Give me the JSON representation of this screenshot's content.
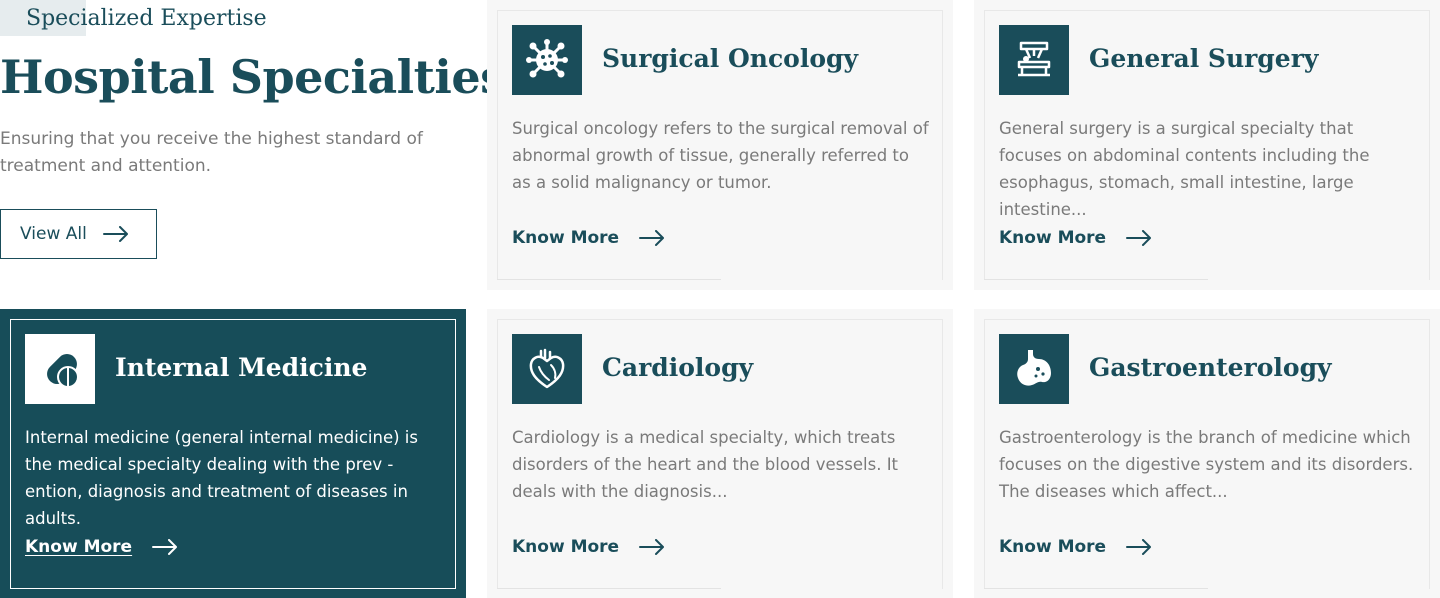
{
  "intro": {
    "eyebrow": "Specialized Expertise",
    "title": "Hospital Specialties",
    "description": "Ensuring that you receive the highest standard of treatment and attention.",
    "view_all_label": "View All"
  },
  "colors": {
    "brand": "#1a4d5a",
    "active_card": "#174d59",
    "card_bg": "#f7f7f7",
    "muted_text": "#7a7a7a"
  },
  "cards": [
    {
      "title": "Surgical Oncology",
      "icon": "cancer-cell-icon",
      "description": "Surgical oncology refers to the surgical removal of abnormal growth of tissue, generally referred to as a solid malignancy or tumor.",
      "link_label": "Know More",
      "active": false
    },
    {
      "title": "General Surgery",
      "icon": "surgery-table-icon",
      "description": "General surgery is a surgical specialty that focuses on abdominal contents including the esophagus, stomach, small intestine, large intestine...",
      "link_label": "Know More",
      "active": false
    },
    {
      "title": "Internal Medicine",
      "icon": "pills-icon",
      "description": "Internal medicine (general internal medicine) is the medical specialty dealing with the prev - ention, diagnosis and treatment of diseases in adults.",
      "link_label": "Know More",
      "active": true
    },
    {
      "title": "Cardiology",
      "icon": "heart-icon",
      "description": "Cardiology is a medical specialty, which treats disorders of the heart and the blood vessels. It deals with the diagnosis...",
      "link_label": "Know More",
      "active": false
    },
    {
      "title": "Gastroenterology",
      "icon": "stomach-icon",
      "description": "Gastroenterology is the branch of medicine which focuses on the digestive system and its disorders. The diseases which affect...",
      "link_label": "Know More",
      "active": false
    }
  ]
}
